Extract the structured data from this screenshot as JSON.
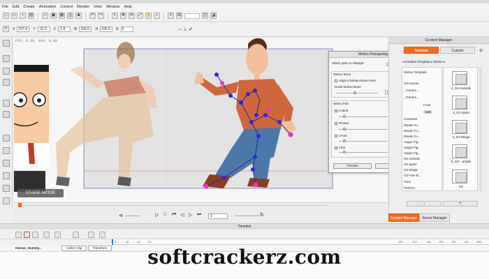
{
  "menu": [
    "File",
    "Edit",
    "Create",
    "Animation",
    "Control",
    "Render",
    "View",
    "Window",
    "Help"
  ],
  "transform": {
    "x_label": "X",
    "x_value": "107.4",
    "y_label": "Y",
    "y_value": "-21.0",
    "z_label": "Z",
    "z_value": "-1.5",
    "w_label": "W",
    "w_value": "100.0",
    "h_label": "H",
    "h_value": "100.0",
    "r_label": "R",
    "r_value": "0"
  },
  "stage": {
    "fps_text": "FPS: 0.00, AVG: 0.00",
    "stage_mode_label": "STAGE MODE",
    "frame_value": "1"
  },
  "motion_retargeting": {
    "title": "Motion Retargeting",
    "select_parts_label": "Select parts to retarget:",
    "additional_info_link": "Additional Info",
    "motion_bone_label": "Motion Bone",
    "align_label": "Align to Motion Bone Pose",
    "scale_label": "Scale Motion Bone",
    "scale_value": "100",
    "select_part_label": "Select Part",
    "parts": [
      {
        "label": "LHand",
        "value": ""
      },
      {
        "label": "RHand",
        "value": ""
      },
      {
        "label": "LFoot",
        "value": "0"
      },
      {
        "label": "LToe",
        "value": "0"
      }
    ],
    "preview_button": "Preview",
    "reset_all_button": "Reset All"
  },
  "content_manager": {
    "title": "Content Manager",
    "tab_template": "Template",
    "tab_custom": "Custom",
    "breadcrumb": "Animation Template ▸ Motion ▸",
    "tree_items": [
      "Motion Template",
      "G3 Human",
      "_Turners...",
      "_Turners...",
      "Front",
      "Side",
      "Caveman",
      "Elastic Fo...",
      "Elastic Fo...",
      "Elastic Fo...",
      "Vogue Fig...",
      "Vogue Fig...",
      "Vogue Fig...",
      "G3 Animals",
      "G3 Spine",
      "G3 Wings",
      "G3 Free B...",
      "Face",
      "Perform"
    ],
    "thumbnails": [
      "2_G3 Animals",
      "3_G3 Spine",
      "4_G3 Wings",
      "5_G3 ...ample",
      "G2"
    ],
    "add_button": "+",
    "down_button": "↓",
    "manager_tab_content": "Content Manager",
    "manager_tab_scene": "Scene Manager"
  },
  "timeline": {
    "title": "Timeline",
    "track_name": "Human_Dummy...",
    "collect_clip": "Collect Clip",
    "transform": "Transform",
    "ruler": [
      "5",
      "10",
      "15",
      "20",
      "130",
      "140",
      "145",
      "150",
      "155",
      "160",
      "165"
    ]
  },
  "watermark": "softcrackerz.com",
  "colors": {
    "accent": "#f36d1f",
    "bone_pink": "#e833c8",
    "bone_blue": "#2b2bd6",
    "bone_line": "#2a2a8a"
  }
}
